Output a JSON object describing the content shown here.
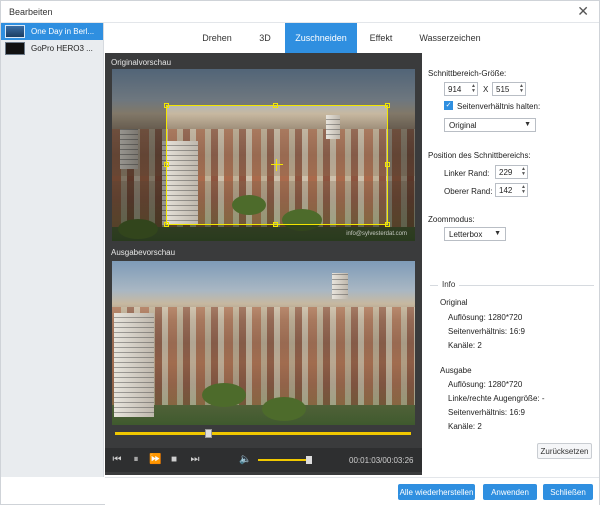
{
  "window": {
    "title": "Bearbeiten",
    "close_icon": "close-icon"
  },
  "files": [
    {
      "name": "One Day in Berl...",
      "active": true
    },
    {
      "name": "GoPro HERO3 ...",
      "active": false
    }
  ],
  "tabs": [
    {
      "label": "Drehen",
      "active": false
    },
    {
      "label": "3D",
      "active": false
    },
    {
      "label": "Zuschneiden",
      "active": true
    },
    {
      "label": "Effekt",
      "active": false
    },
    {
      "label": "Wasserzeichen",
      "active": false
    }
  ],
  "preview": {
    "original_label": "Originalvorschau",
    "output_label": "Ausgabevorschau",
    "watermark": "info@sylvesterdat.com",
    "time": "00:01:03/00:03:26",
    "seek_progress": 0.3,
    "volume_level": 1.0
  },
  "crop": {
    "size_label": "Schnittbereich-Größe:",
    "width": "914",
    "separator": "X",
    "height": "515",
    "keep_ratio_label": "Seitenverhältnis halten:",
    "keep_ratio_checked": true,
    "ratio_value": "Original",
    "position_label": "Position des Schnittbereichs:",
    "left_label": "Linker Rand:",
    "left_value": "229",
    "top_label": "Oberer Rand:",
    "top_value": "142",
    "zoom_label": "Zoommodus:",
    "zoom_value": "Letterbox"
  },
  "info": {
    "title": "Info",
    "original_heading": "Original",
    "original": {
      "resolution": "Auflösung: 1280*720",
      "ratio": "Seitenverhältnis: 16:9",
      "channels": "Kanäle: 2"
    },
    "output_heading": "Ausgabe",
    "output": {
      "resolution": "Auflösung: 1280*720",
      "eye": "Linke/rechte Augengröße: -",
      "ratio": "Seitenverhältnis: 16:9",
      "channels": "Kanäle: 2"
    }
  },
  "buttons": {
    "reset": "Zurücksetzen",
    "restore_all": "Alle wiederherstellen",
    "apply": "Anwenden",
    "close": "Schließen"
  },
  "colors": {
    "accent": "#2f8fe0",
    "crop_frame": "#f2e600",
    "seek": "#f0c800"
  }
}
